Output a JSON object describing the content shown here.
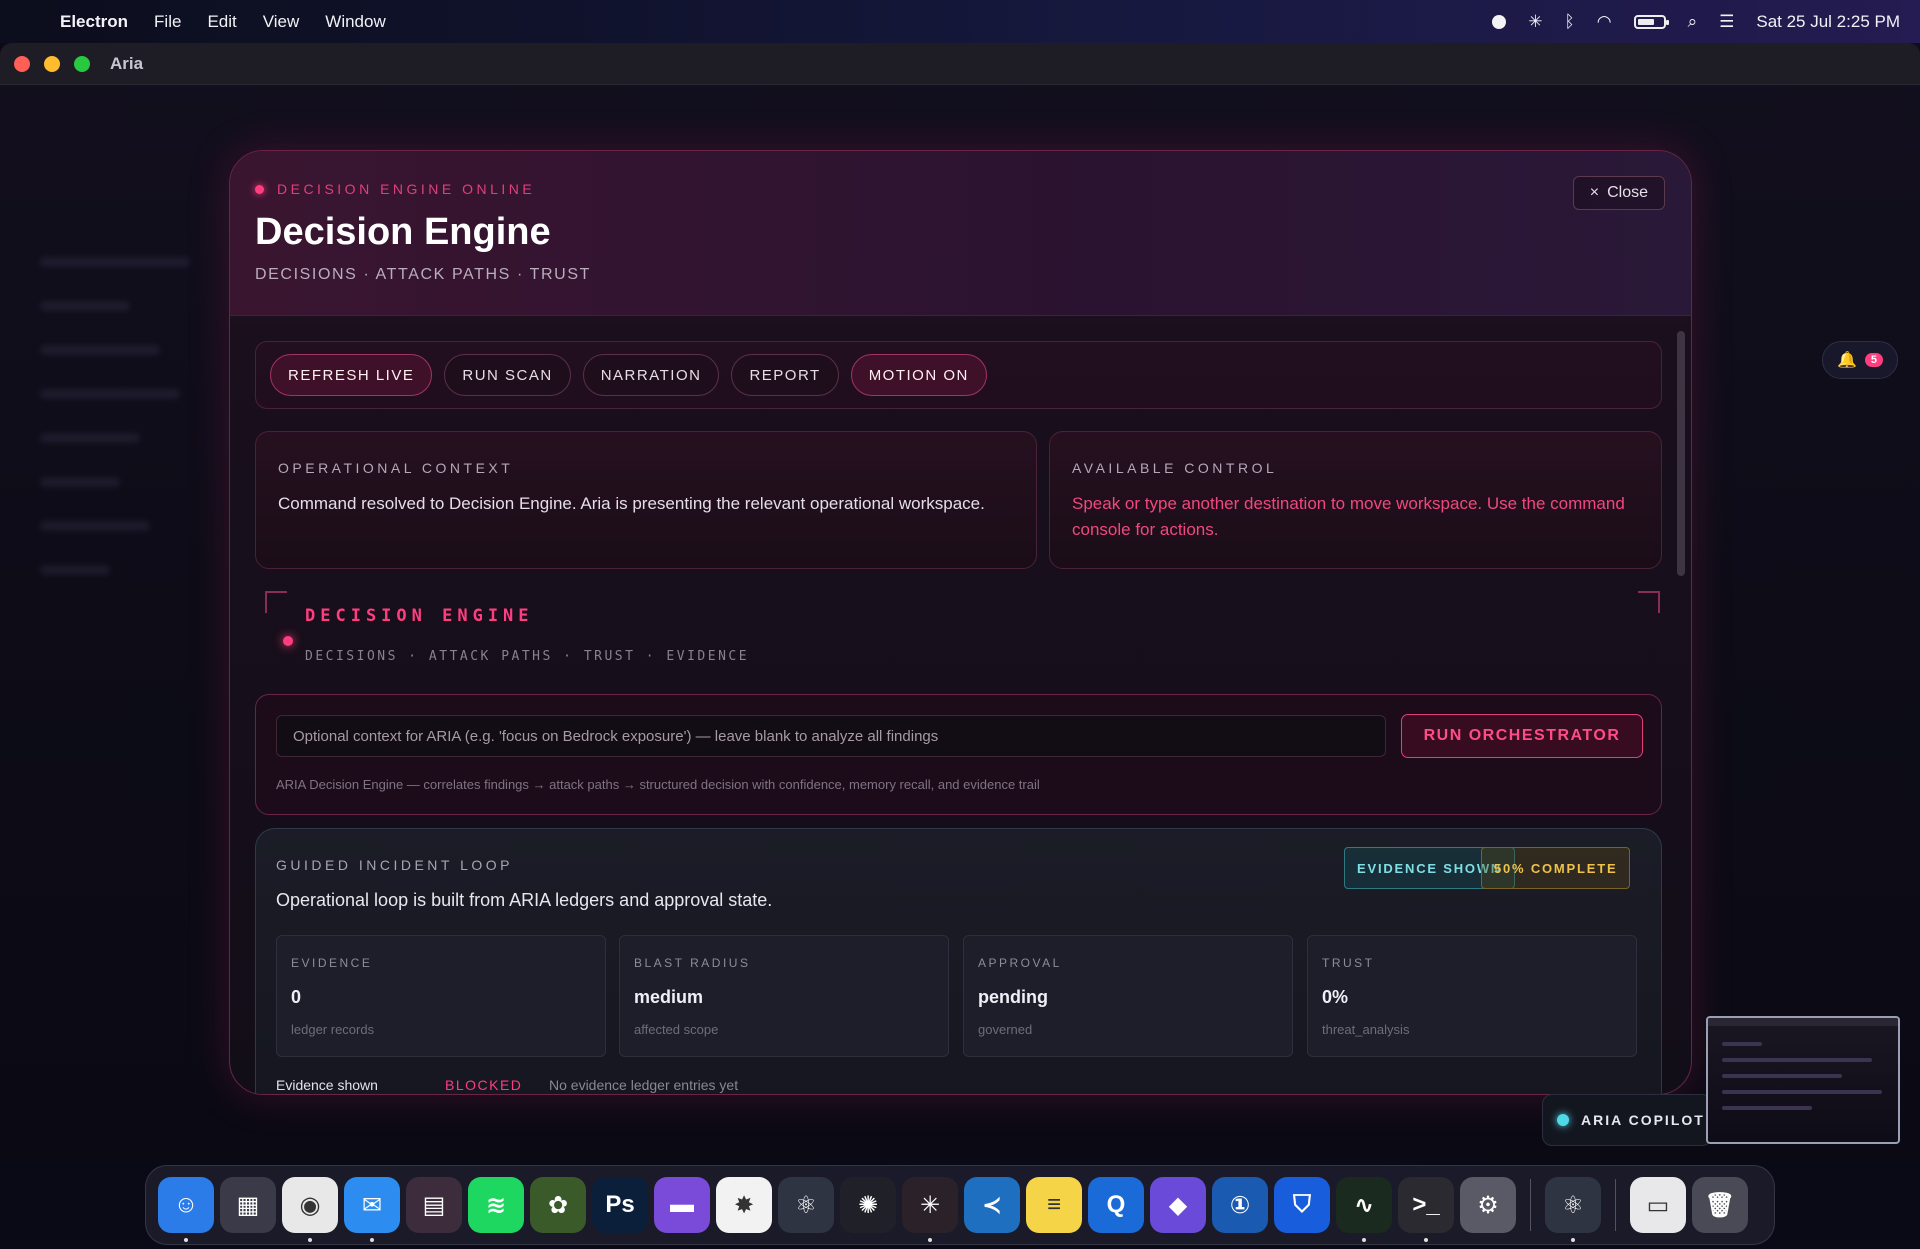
{
  "menubar": {
    "app_name": "Electron",
    "menus": [
      "File",
      "Edit",
      "View",
      "Window"
    ],
    "clock": "Sat 25 Jul  2:25 PM",
    "battery_level": 0.7
  },
  "window": {
    "title": "Aria"
  },
  "modal": {
    "status": "DECISION ENGINE ONLINE",
    "title": "Decision Engine",
    "subtitle": "DECISIONS · ATTACK PATHS · TRUST",
    "close_label": "Close",
    "toolbar": {
      "refresh": "REFRESH LIVE",
      "scan": "RUN SCAN",
      "narration": "NARRATION",
      "report": "REPORT",
      "motion": "MOTION ON"
    },
    "operational_context": {
      "label": "OPERATIONAL CONTEXT",
      "text": "Command resolved to Decision Engine. Aria is presenting the relevant operational workspace."
    },
    "available_control": {
      "label": "AVAILABLE CONTROL",
      "text": "Speak or type another destination to move workspace. Use the command console for actions."
    },
    "banner": {
      "title": "DECISION ENGINE",
      "subtitle": "DECISIONS · ATTACK PATHS · TRUST · EVIDENCE"
    },
    "orchestrator": {
      "placeholder": "Optional context for ARIA (e.g. 'focus on Bedrock exposure') — leave blank to analyze all findings",
      "button": "RUN ORCHESTRATOR",
      "hint": "ARIA Decision Engine — correlates findings → attack paths → structured decision with confidence, memory recall, and evidence trail"
    },
    "loop": {
      "label": "GUIDED INCIDENT LOOP",
      "description": "Operational loop is built from ARIA ledgers and approval state.",
      "badge_evidence": "EVIDENCE SHOWN",
      "badge_complete": "50% COMPLETE",
      "metrics": [
        {
          "label": "EVIDENCE",
          "value": "0",
          "note": "ledger records"
        },
        {
          "label": "BLAST RADIUS",
          "value": "medium",
          "note": "affected scope"
        },
        {
          "label": "APPROVAL",
          "value": "pending",
          "note": "governed"
        },
        {
          "label": "TRUST",
          "value": "0%",
          "note": "threat_analysis"
        }
      ],
      "row": {
        "name": "Evidence shown",
        "status": "BLOCKED",
        "detail": "No evidence ledger entries yet"
      }
    }
  },
  "notifications": {
    "count": "5"
  },
  "copilot": {
    "label": "ARIA COPILOT"
  },
  "dock": {
    "icons": [
      {
        "name": "finder-icon",
        "text": "☺",
        "bg": "#2b7ce9",
        "running": true
      },
      {
        "name": "launchpad-icon",
        "text": "▦",
        "bg": "#3a3a48",
        "running": false
      },
      {
        "name": "chrome-icon",
        "text": "◉",
        "bg": "#e8e8e8",
        "running": true
      },
      {
        "name": "mail-icon",
        "text": "✉",
        "bg": "#2d8cf0",
        "running": true
      },
      {
        "name": "calendar-grid-icon",
        "text": "▤",
        "bg": "#3c2c3c",
        "running": false
      },
      {
        "name": "spotify-icon",
        "text": "≋",
        "bg": "#1ed760",
        "running": false
      },
      {
        "name": "tropical-app-icon",
        "text": "✿",
        "bg": "#3a5a2a",
        "running": false
      },
      {
        "name": "photoshop-icon",
        "text": "Ps",
        "bg": "#0b1e3a",
        "running": false
      },
      {
        "name": "clapper-icon",
        "text": "▬",
        "bg": "#7a4ad8",
        "running": false
      },
      {
        "name": "photos-icon",
        "text": "✸",
        "bg": "#f2f2f2",
        "running": false
      },
      {
        "name": "electron-icon",
        "text": "⚛",
        "bg": "#2e3442",
        "running": false
      },
      {
        "name": "chatgpt-icon",
        "text": "✺",
        "bg": "#202028",
        "running": false
      },
      {
        "name": "claude-icon",
        "text": "✳",
        "bg": "#2a2228",
        "running": true
      },
      {
        "name": "vscode-icon",
        "text": "≺",
        "bg": "#1f6fc0",
        "running": false
      },
      {
        "name": "notes-icon",
        "text": "≡",
        "bg": "#f5d547",
        "running": false
      },
      {
        "name": "quicktime-icon",
        "text": "Q",
        "bg": "#1a6ad8",
        "running": false
      },
      {
        "name": "proton-icon",
        "text": "◆",
        "bg": "#6a4ad8",
        "running": false
      },
      {
        "name": "onepassword-icon",
        "text": "①",
        "bg": "#1a5ab0",
        "running": false
      },
      {
        "name": "bitwarden-icon",
        "text": "⛉",
        "bg": "#175ddc",
        "running": false
      },
      {
        "name": "activity-monitor-icon",
        "text": "∿",
        "bg": "#1a2a1e",
        "running": true
      },
      {
        "name": "terminal-icon",
        "text": ">_",
        "bg": "#2a2a30",
        "running": true
      },
      {
        "name": "settings-icon",
        "text": "⚙",
        "bg": "#5a5a66",
        "running": false
      },
      {
        "name": "electron-app-icon",
        "text": "⚛",
        "bg": "#2e3442",
        "running": true
      },
      {
        "name": "document-icon",
        "text": "▭",
        "bg": "#e8e8ea",
        "running": false
      },
      {
        "name": "trash-icon",
        "text": "🗑",
        "bg": "#4a4a56",
        "running": false
      }
    ]
  }
}
